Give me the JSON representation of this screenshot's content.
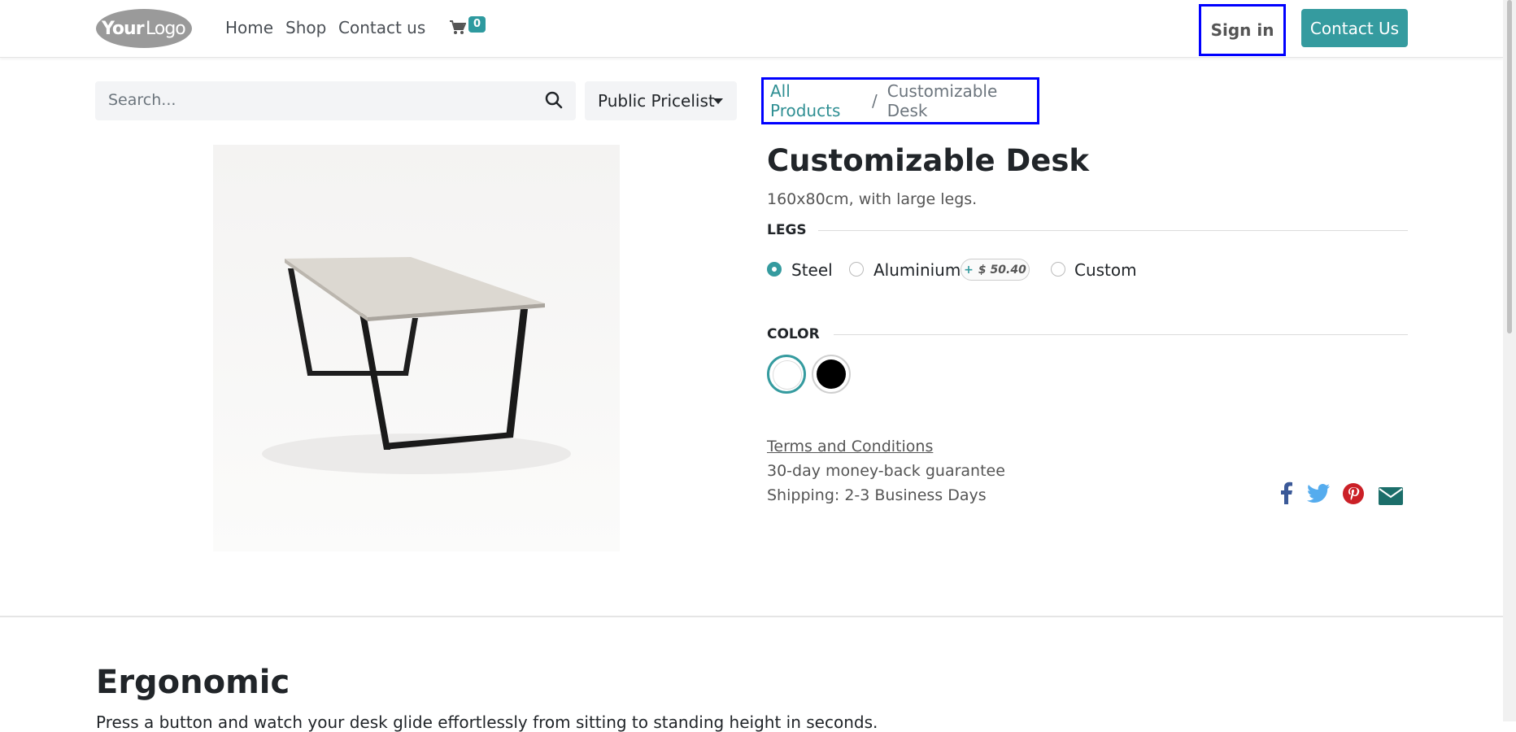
{
  "header": {
    "logo_text": "YourLogo",
    "nav": [
      "Home",
      "Shop",
      "Contact us"
    ],
    "cart_count": "0",
    "sign_in": "Sign in",
    "contact_button": "Contact Us"
  },
  "search": {
    "placeholder": "Search..."
  },
  "pricelist": {
    "selected": "Public Pricelist"
  },
  "breadcrumb": {
    "parent": "All Products",
    "separator": "/",
    "current": "Customizable Desk"
  },
  "product": {
    "name": "Customizable Desk",
    "description": "160x80cm, with large legs.",
    "attributes": {
      "legs": {
        "label": "LEGS",
        "options": [
          "Steel",
          "Aluminium",
          "Custom"
        ],
        "selected": "Steel",
        "aluminium_extra_sign": "+",
        "aluminium_extra_price": "$ 50.40"
      },
      "color": {
        "label": "COLOR",
        "options": [
          "White",
          "Black"
        ],
        "selected": "White"
      }
    },
    "terms_link": "Terms and Conditions",
    "guarantee": "30-day money-back guarantee",
    "shipping": "Shipping: 2-3 Business Days"
  },
  "share_icons": [
    "facebook-icon",
    "twitter-icon",
    "pinterest-icon",
    "email-icon"
  ],
  "colors": {
    "accent": "#359b9f",
    "highlight_box": "#0000ff",
    "facebook": "#3b5998",
    "twitter": "#55acee",
    "pinterest": "#cb2027",
    "email": "#1c6e6a"
  },
  "section": {
    "title": "Ergonomic",
    "text": "Press a button and watch your desk glide effortlessly from sitting to standing height in seconds."
  }
}
